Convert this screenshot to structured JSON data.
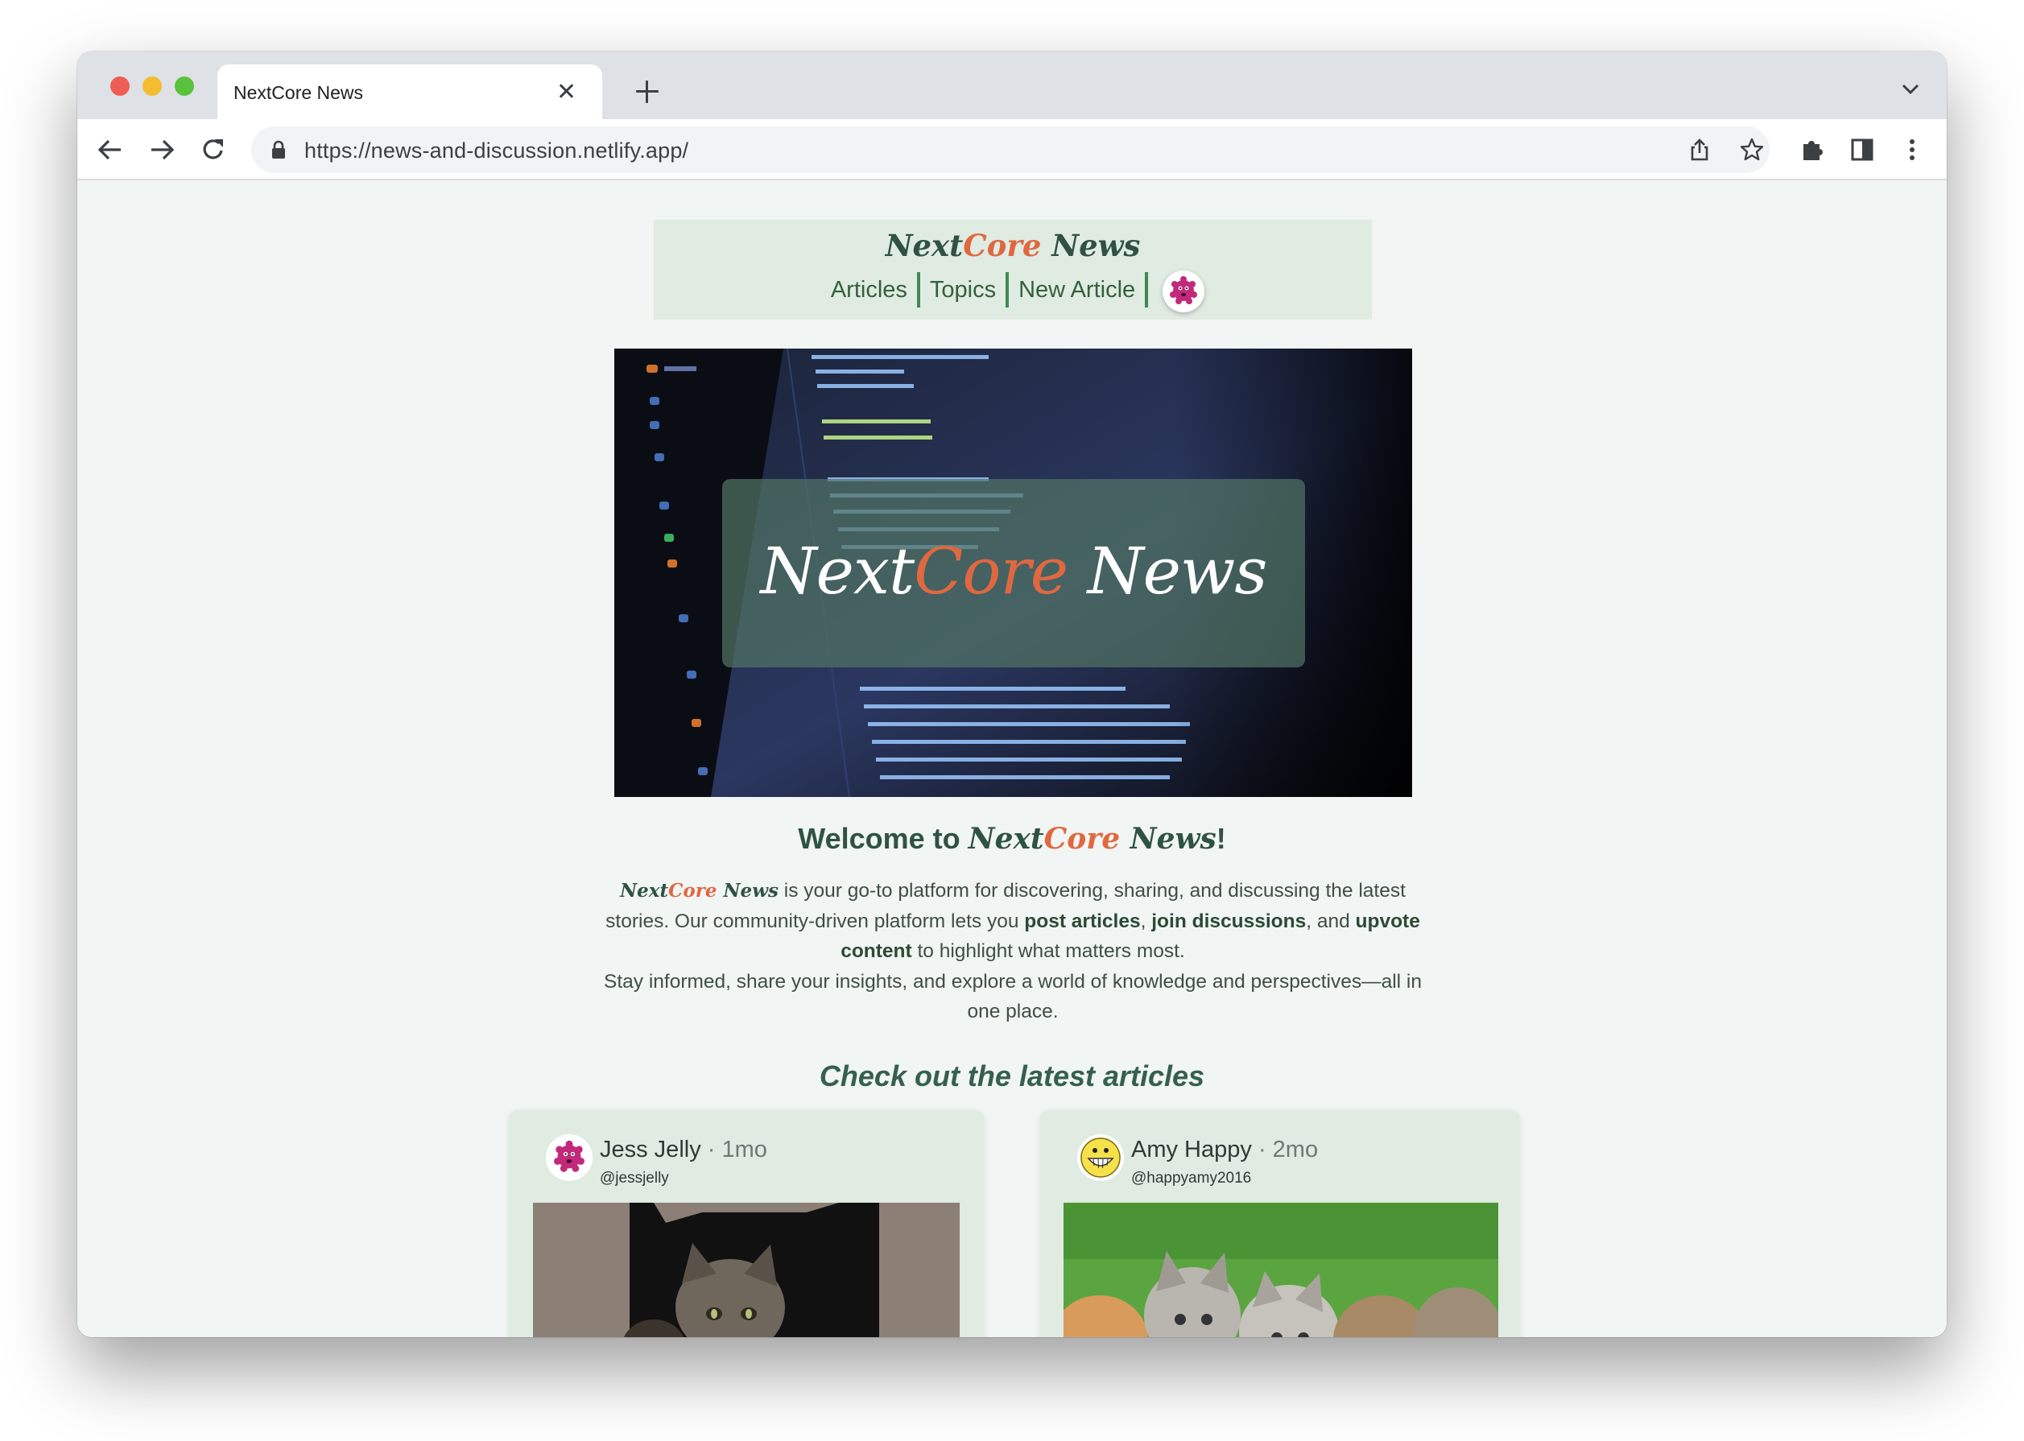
{
  "browser": {
    "tab_title": "NextCore News",
    "url": "https://news-and-discussion.netlify.app/",
    "icons": [
      "back-arrow-icon",
      "forward-arrow-icon",
      "reload-icon",
      "lock-icon",
      "share-icon",
      "bookmark-star-icon",
      "extensions-puzzle-icon",
      "side-panel-icon",
      "more-vertical-icon",
      "close-icon",
      "plus-icon",
      "chevron-down-icon"
    ]
  },
  "site": {
    "brand_next": "Next",
    "brand_core": "Core",
    "brand_news": "News",
    "nav": {
      "articles": "Articles",
      "topics": "Topics",
      "new_article": "New Article"
    }
  },
  "hero": {
    "title_next": "Next",
    "title_core": "Core",
    "title_news": "News"
  },
  "welcome": {
    "prefix": "Welcome to ",
    "suffix": "!"
  },
  "intro": {
    "p1": " is your go-to platform for discovering, sharing, and discussing the latest stories. Our community-driven platform lets you ",
    "post_articles": "post articles",
    "comma": ", ",
    "join_discussions": "join discussions",
    "and": ", and ",
    "upvote_content": "upvote content",
    "p1_end": " to highlight what matters most.",
    "p2": "Stay informed, share your insights, and explore a world of knowledge and perspectives—all in one place."
  },
  "latest_heading": "Check out the latest articles",
  "articles": [
    {
      "author": "Jess Jelly",
      "time": "1mo",
      "handle": "@jessjelly",
      "dot": " · "
    },
    {
      "author": "Amy Happy",
      "time": "2mo",
      "handle": "@happyamy2016",
      "dot": " · "
    }
  ],
  "colors": {
    "brand_green": "#2f5244",
    "brand_orange": "#e06840",
    "header_bg": "#e0ebe2",
    "page_bg": "#f1f5f3"
  }
}
